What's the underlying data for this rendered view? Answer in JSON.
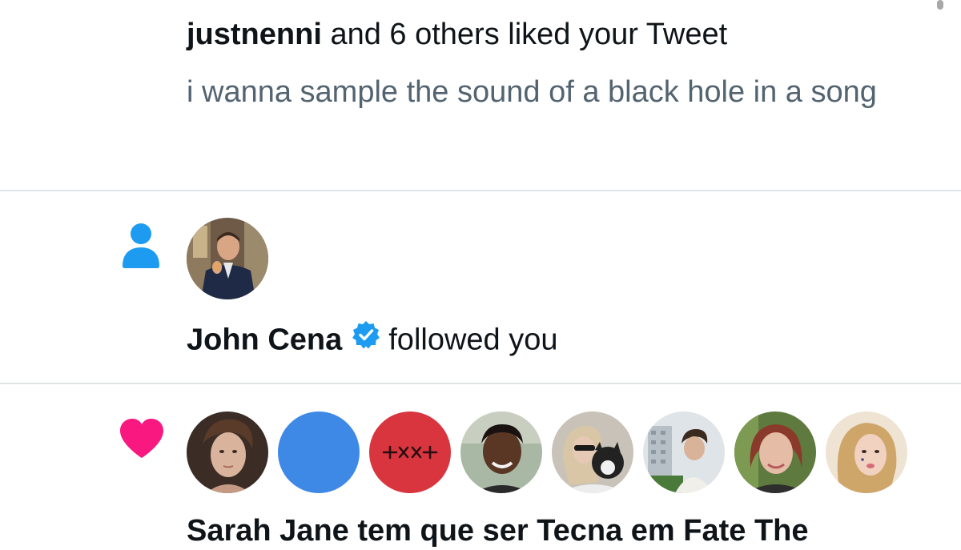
{
  "like_notification_1": {
    "actor": "justnenni",
    "action_text": " and 6 others liked your Tweet",
    "tweet_preview": "i wanna sample the sound of a black hole in a song"
  },
  "follow_notification": {
    "actor": "John Cena",
    "action_text": "followed you",
    "verified": true
  },
  "like_notification_2": {
    "tweet_preview": "Sarah Jane tem que ser Tecna em Fate The",
    "avatar_count": 8
  },
  "icons": {
    "follow": "person-icon",
    "like": "heart-icon",
    "verified": "verified-badge-icon"
  },
  "colors": {
    "follow_icon": "#1d9bf0",
    "like_icon": "#f91880",
    "verified": "#1d9bf0",
    "secondary_text": "#536471",
    "divider": "#e1e4e7"
  }
}
